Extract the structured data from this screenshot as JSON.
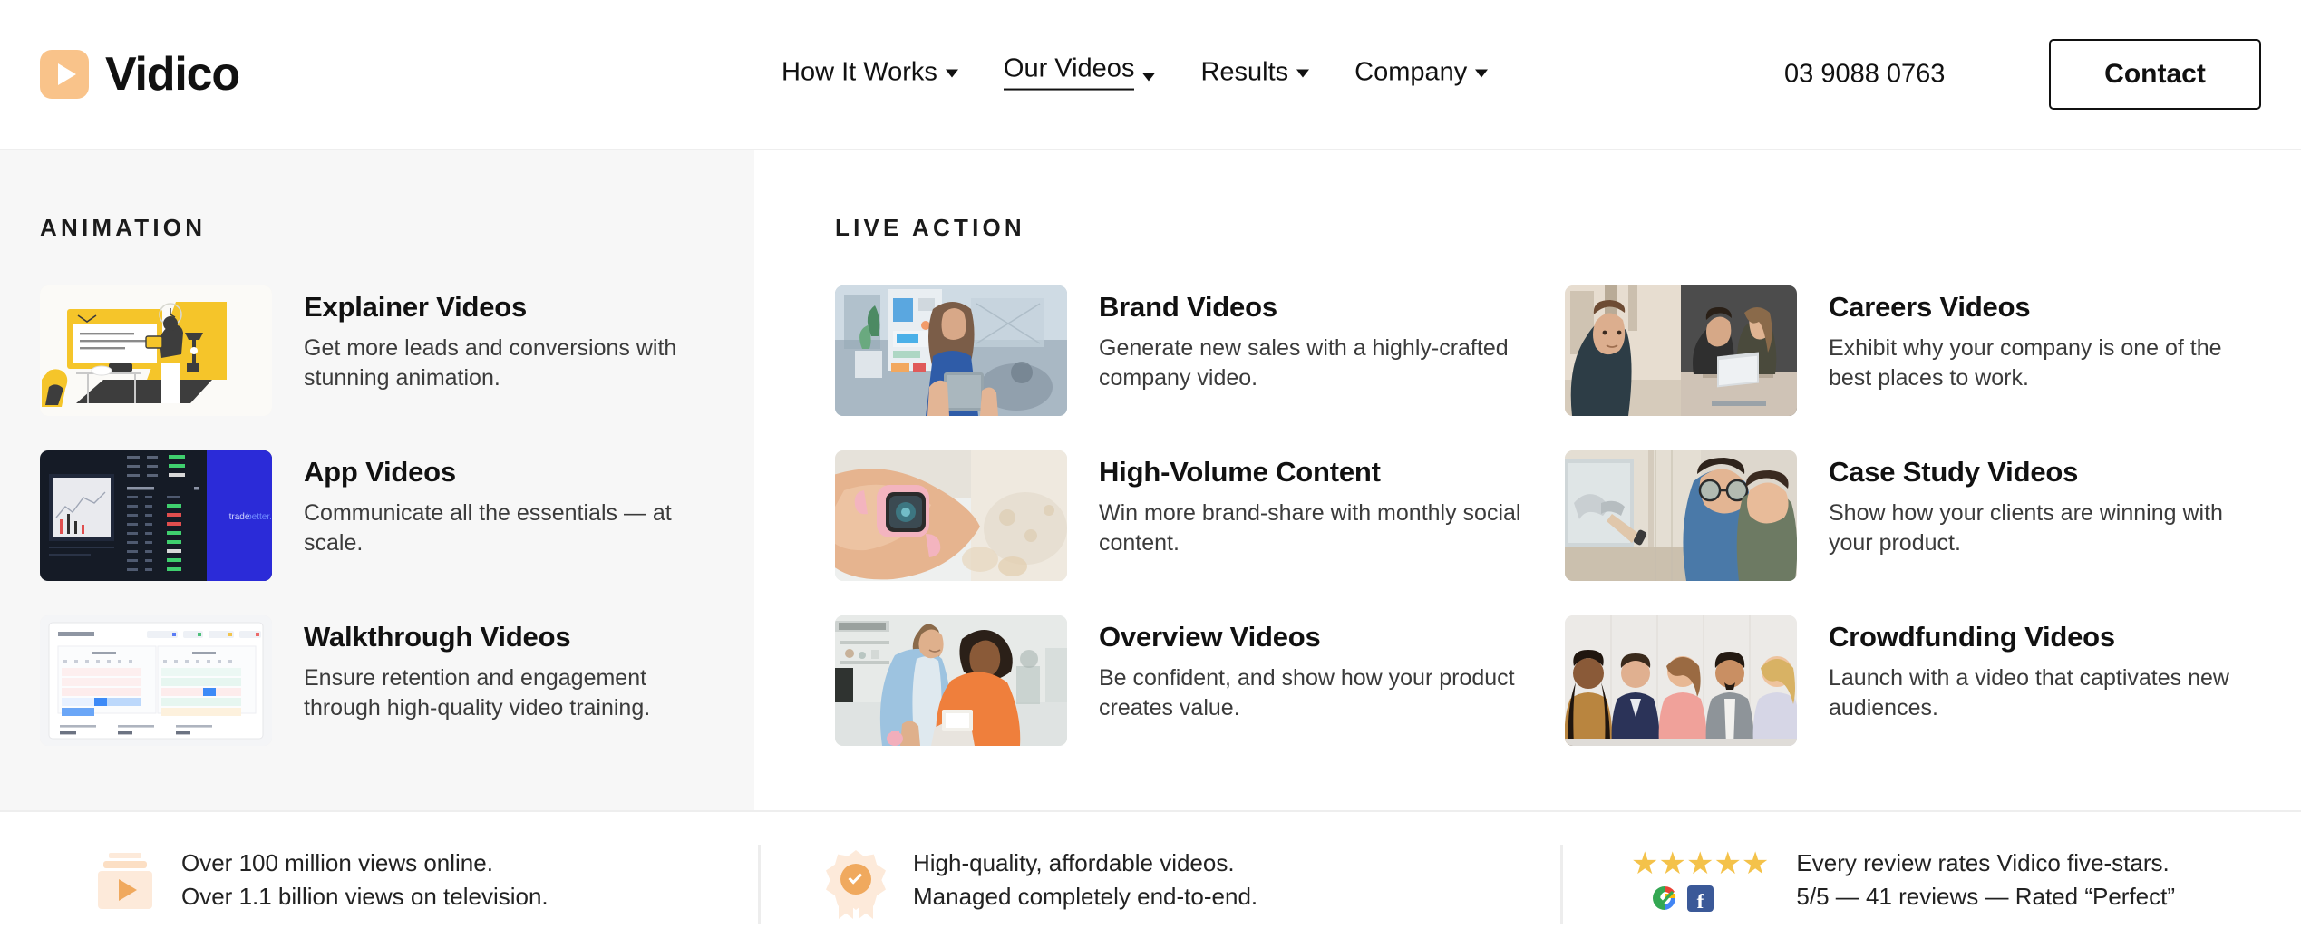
{
  "brand": {
    "name": "Vidico",
    "logo_icon": "play-icon",
    "accent": "#f9c38a"
  },
  "header": {
    "nav": [
      {
        "label": "How It Works",
        "has_dropdown": true,
        "active": false
      },
      {
        "label": "Our Videos",
        "has_dropdown": true,
        "active": true
      },
      {
        "label": "Results",
        "has_dropdown": true,
        "active": false
      },
      {
        "label": "Company",
        "has_dropdown": true,
        "active": false
      }
    ],
    "phone": "03 9088 0763",
    "contact_label": "Contact"
  },
  "panel": {
    "animation": {
      "title": "ANIMATION",
      "items": [
        {
          "title": "Explainer Videos",
          "desc": "Get more leads and conversions with stunning animation."
        },
        {
          "title": "App Videos",
          "desc": "Communicate all the essentials — at scale."
        },
        {
          "title": "Walkthrough Videos",
          "desc": "Ensure retention and engagement through high-quality video training."
        }
      ]
    },
    "live_action": {
      "title": "LIVE ACTION",
      "items": [
        {
          "title": "Brand Videos",
          "desc": "Generate new sales with a highly-crafted company video."
        },
        {
          "title": "Careers Videos",
          "desc": "Exhibit why your company is one of the best places to work."
        },
        {
          "title": "High-Volume Content",
          "desc": "Win more brand-share with monthly social content."
        },
        {
          "title": "Case Study Videos",
          "desc": "Show how your clients are winning with your product."
        },
        {
          "title": "Overview Videos",
          "desc": "Be confident, and show how your product creates value."
        },
        {
          "title": "Crowdfunding Videos",
          "desc": "Launch with a video that captivates new audiences."
        }
      ]
    }
  },
  "bottom_bar": {
    "stats": [
      {
        "icon": "film-play-icon",
        "line1": "Over 100 million views online.",
        "line2": "Over 1.1 billion views on television."
      },
      {
        "icon": "quality-badge-icon",
        "line1": "High-quality, affordable videos.",
        "line2": "Managed completely end-to-end."
      },
      {
        "icon": "five-stars-icon",
        "stars": "★★★★★",
        "line1": "Every review rates Vidico five-stars.",
        "line2": "5/5 — 41 reviews — Rated “Perfect”",
        "review_logos": [
          "google-review-icon",
          "facebook-review-icon"
        ],
        "facebook_glyph": "f"
      }
    ]
  }
}
